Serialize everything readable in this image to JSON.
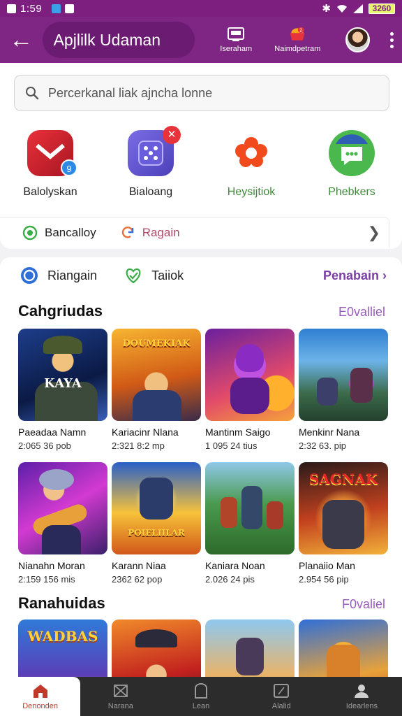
{
  "status_bar": {
    "time": "1:59",
    "battery": "3260"
  },
  "app_bar": {
    "title": "Apjlilk Udaman",
    "action1_label": "Iseraham",
    "action2_label": "Naimdpetram"
  },
  "search": {
    "placeholder": "Percerkanal liak ajncha lonne"
  },
  "shortcuts": [
    {
      "label": "Balolyskan",
      "badge": "9",
      "color": "#222222"
    },
    {
      "label": "Bialoang",
      "badge": "✕",
      "color": "#222222"
    },
    {
      "label": "Heysijtiok",
      "color": "#3e8a3a"
    },
    {
      "label": "Phebkers",
      "color": "#3e8a3a"
    }
  ],
  "quick_links": {
    "first": "Bancalloy",
    "second": "Ragain"
  },
  "filters": {
    "first": "Riangain",
    "second": "Taiiok",
    "link": "Penabain"
  },
  "sections": [
    {
      "title": "Cahgriudas",
      "link": "E0valliel",
      "games": [
        {
          "name": "Paeadaa Namn",
          "meta": "2:065   36 pob",
          "art": "KAYA"
        },
        {
          "name": "Kariacinr Nlana",
          "meta": "2:321   8:2 mp",
          "art": "DOUMEKIAK"
        },
        {
          "name": "Mantinm Saigo",
          "meta": "1 095   24 tius",
          "art": ""
        },
        {
          "name": "Menkinr Nana",
          "meta": "2:32   63. pip",
          "art": ""
        },
        {
          "name": "Nianahn Moran",
          "meta": "2:159   156 mis",
          "art": ""
        },
        {
          "name": "Karann Niaa",
          "meta": "2362   62 pop",
          "art": "POIELIILAR"
        },
        {
          "name": "Kaniara Noan",
          "meta": "2.026   24 pis",
          "art": ""
        },
        {
          "name": "Planaiio Man",
          "meta": "2.954   56 pip",
          "art": "SAGNAK"
        }
      ]
    },
    {
      "title": "Ranahuidas",
      "link": "F0valiel",
      "games": [
        {
          "name": "",
          "meta": "",
          "art": "WADBAS"
        },
        {
          "name": "",
          "meta": "",
          "art": ""
        },
        {
          "name": "",
          "meta": "",
          "art": ""
        },
        {
          "name": "",
          "meta": "",
          "art": ""
        }
      ]
    }
  ],
  "bottom_nav": [
    {
      "label": "Denonden",
      "icon": "home-icon"
    },
    {
      "label": "Narana",
      "icon": "cross-icon"
    },
    {
      "label": "Lean",
      "icon": "bookmark-icon"
    },
    {
      "label": "Alalid",
      "icon": "tablet-icon"
    },
    {
      "label": "Idearlens",
      "icon": "person-icon"
    }
  ],
  "colors": {
    "primary": "#7f2584",
    "accent_link": "#9b5cc0",
    "nav_active": "#c0392b"
  }
}
